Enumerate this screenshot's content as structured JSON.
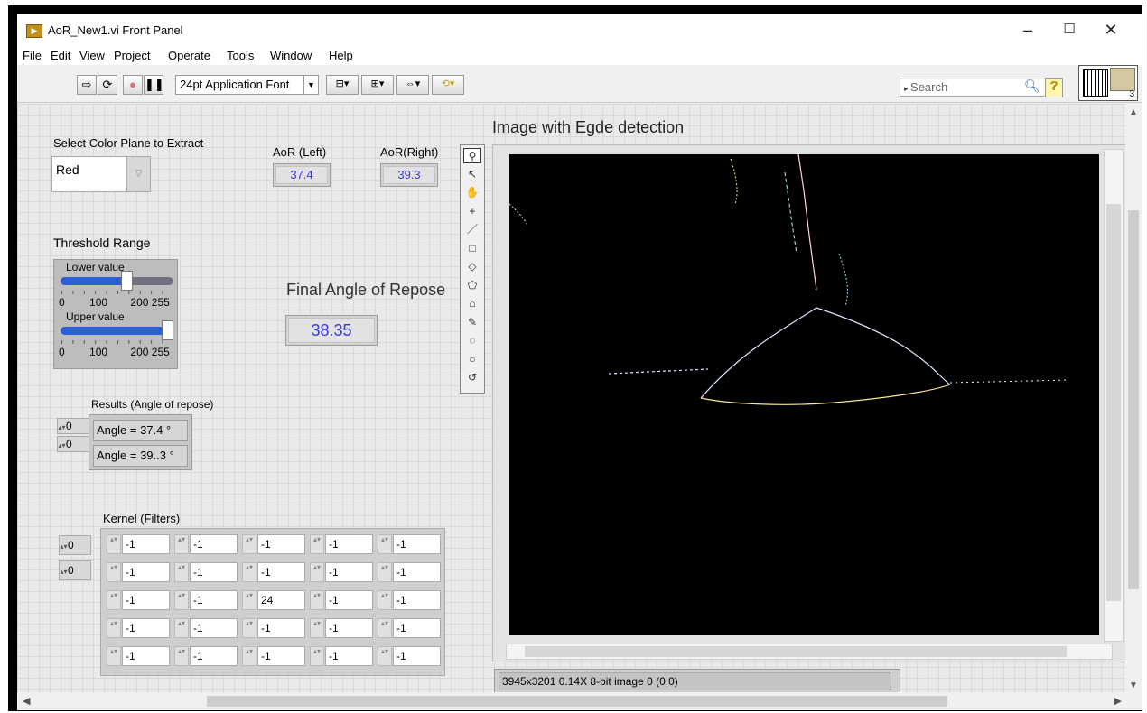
{
  "window": {
    "title": "AoR_New1.vi Front Panel",
    "app_icon": "labview-vi-icon",
    "controls": {
      "minimize": "–",
      "maximize": "☐",
      "close": "✕"
    }
  },
  "menu": [
    "File",
    "Edit",
    "View",
    "Project",
    "Operate",
    "Tools",
    "Window",
    "Help"
  ],
  "toolbar": {
    "font": "24pt Application Font",
    "search_placeholder": "Search",
    "help": "?",
    "connector_number": "3"
  },
  "panel": {
    "color_plane": {
      "label": "Select Color Plane to Extract",
      "value": "Red"
    },
    "aor_left": {
      "label": "AoR (Left)",
      "value": "37.4"
    },
    "aor_right": {
      "label": "AoR(Right)",
      "value": "39.3"
    },
    "final": {
      "label": "Final Angle of Repose",
      "value": "38.35"
    },
    "threshold": {
      "label": "Threshold Range",
      "lower_label": "Lower value",
      "upper_label": "Upper value",
      "scale": [
        "0",
        "100",
        "200",
        "255"
      ],
      "lower_fraction": 0.6,
      "upper_fraction": 1.0
    },
    "results": {
      "label": "Results (Angle of repose)",
      "index_row": "0",
      "index_col": "0",
      "values": [
        "Angle = 37.4 °",
        "Angle = 39..3 °"
      ]
    },
    "kernel": {
      "label": "Kernel (Filters)",
      "index_row": "0",
      "index_col": "0",
      "rows": [
        [
          "-1",
          "-1",
          "-1",
          "-1",
          "-1"
        ],
        [
          "-1",
          "-1",
          "-1",
          "-1",
          "-1"
        ],
        [
          "-1",
          "-1",
          "24",
          "-1",
          "-1"
        ],
        [
          "-1",
          "-1",
          "-1",
          "-1",
          "-1"
        ],
        [
          "-1",
          "-1",
          "-1",
          "-1",
          "-1"
        ]
      ]
    },
    "image": {
      "title": "Image with Egde detection",
      "status": "3945x3201 0.14X 8-bit image 0    (0,0)"
    },
    "palette_tools": [
      "zoom-icon",
      "pointer-icon",
      "pan-hand-icon",
      "point-icon",
      "line-icon",
      "rectangle-icon",
      "rotated-rectangle-icon",
      "polygon-icon",
      "freehand-polygon-icon",
      "freehand-icon",
      "annulus-icon",
      "oval-icon",
      "broken-line-icon"
    ]
  }
}
